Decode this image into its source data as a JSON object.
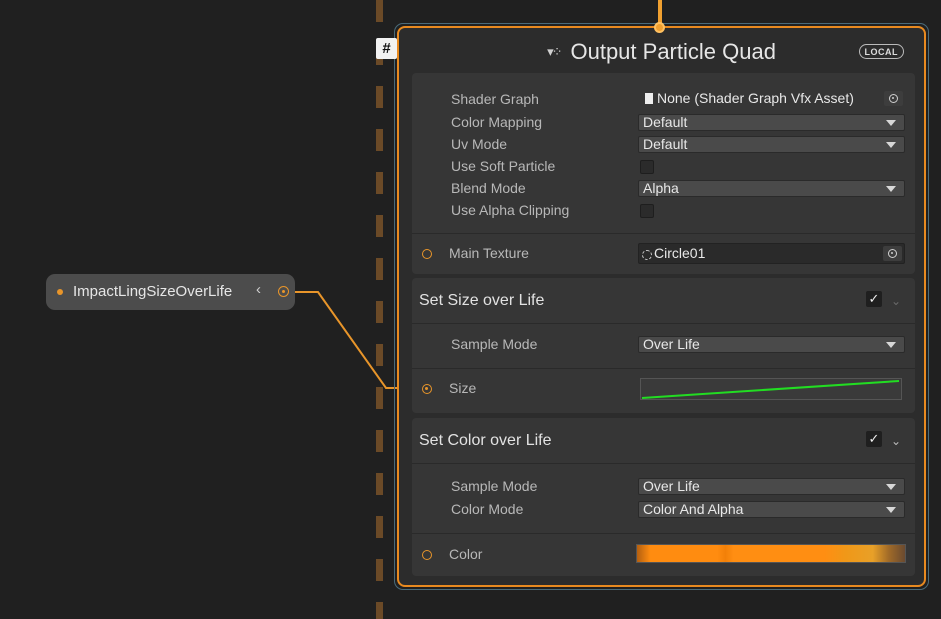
{
  "property_node": {
    "name": "ImpactLingSizeOverLife",
    "collapse_glyph": "‹"
  },
  "context": {
    "badge": "#",
    "icon": "vfx-particles-icon",
    "title": "Output Particle Quad",
    "space_badge": "LOCAL",
    "settings": {
      "shader_graph_label": "Shader Graph",
      "shader_graph_value": "None (Shader Graph Vfx Asset)",
      "color_mapping_label": "Color Mapping",
      "color_mapping_value": "Default",
      "uv_mode_label": "Uv Mode",
      "uv_mode_value": "Default",
      "use_soft_particle_label": "Use Soft Particle",
      "blend_mode_label": "Blend Mode",
      "blend_mode_value": "Alpha",
      "use_alpha_clipping_label": "Use Alpha Clipping",
      "main_texture_label": "Main Texture",
      "main_texture_value": "Circle01"
    },
    "blocks": [
      {
        "title": "Set Size over Life",
        "enabled": true,
        "sample_mode_label": "Sample Mode",
        "sample_mode_value": "Over Life",
        "port_label": "Size"
      },
      {
        "title": "Set Color over Life",
        "enabled": true,
        "sample_mode_label": "Sample Mode",
        "sample_mode_value": "Over Life",
        "color_mode_label": "Color Mode",
        "color_mode_value": "Color And Alpha",
        "port_label": "Color"
      }
    ]
  },
  "colors": {
    "accent": "#e88a20",
    "curve": "#22dd22",
    "background": "#202020"
  }
}
